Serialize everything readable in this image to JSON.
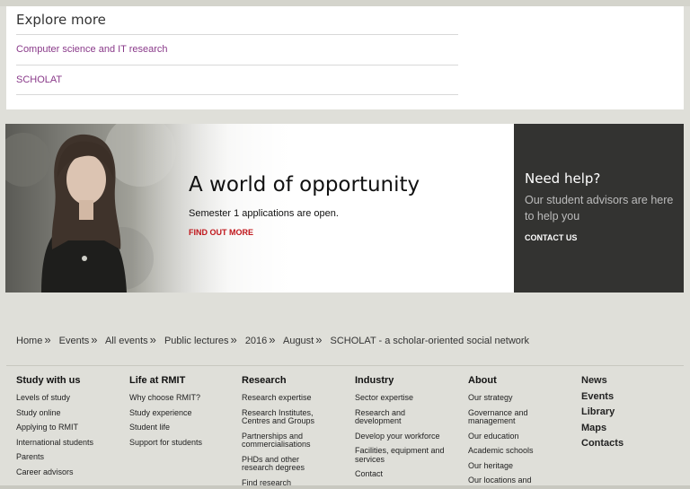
{
  "explore": {
    "title": "Explore more",
    "links": [
      "Computer science and IT research",
      "SCHOLAT"
    ]
  },
  "banner": {
    "heading": "A world of opportunity",
    "subtext": "Semester 1 applications are open.",
    "cta": "FIND OUT MORE"
  },
  "help": {
    "heading": "Need help?",
    "text": "Our student advisors are here to help you",
    "cta": "CONTACT US"
  },
  "breadcrumb": [
    "Home",
    "Events",
    "All events",
    "Public lectures",
    "2016",
    "August",
    "SCHOLAT - a scholar-oriented social network"
  ],
  "breadcrumb_separator": "»",
  "footer": {
    "columns": [
      {
        "title": "Study with us",
        "items": [
          "Levels of study",
          "Study online",
          "Applying to RMIT",
          "International students",
          "Parents",
          "Career advisors"
        ]
      },
      {
        "title": "Life at RMIT",
        "items": [
          "Why choose RMIT?",
          "Study experience",
          "Student life",
          "Support for students"
        ]
      },
      {
        "title": "Research",
        "items": [
          "Research expertise",
          "Research Institutes, Centres and Groups",
          "Partnerships and commercialisations",
          "PHDs and other research degrees",
          "Find research"
        ]
      },
      {
        "title": "Industry",
        "items": [
          "Sector expertise",
          "Research and development",
          "Develop your workforce",
          "Facilities, equipment and services",
          "Contact"
        ]
      },
      {
        "title": "About",
        "items": [
          "Our strategy",
          "Governance and management",
          "Our education",
          "Academic schools",
          "Our heritage",
          "Our locations and"
        ]
      }
    ],
    "quick_links": [
      "News",
      "Events",
      "Library",
      "Maps",
      "Contacts"
    ]
  }
}
